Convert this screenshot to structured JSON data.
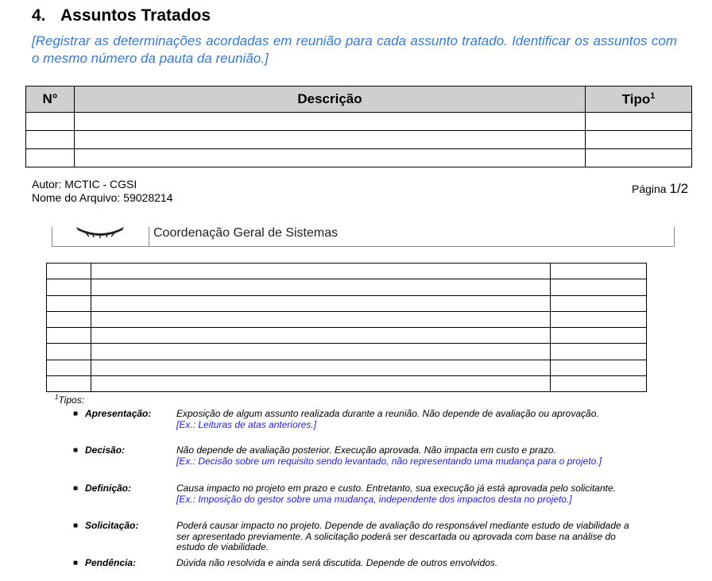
{
  "section": {
    "number": "4.",
    "title": "Assuntos Tratados",
    "instruction": "[Registrar as determinações acordadas em reunião para cada assunto tratado. Identificar os assuntos com o mesmo número da pauta da reunião.]"
  },
  "table1": {
    "headers": {
      "num": "N°",
      "descricao": "Descrição",
      "tipo": "Tipo",
      "tipo_sup": "1"
    },
    "empty_rows": 3
  },
  "footer": {
    "autor": "Autor: MCTIC - CGSI",
    "arquivo": "Nome do Arquivo: 59028214",
    "pagina_label": "Página",
    "pagina_value": "1/2"
  },
  "page2_header": {
    "org": "Coordenação Geral de Sistemas"
  },
  "table2": {
    "empty_rows": 8
  },
  "tipos": {
    "title": "Tipos:",
    "title_sup": "1",
    "items": [
      {
        "name": "Apresentação:",
        "desc": "Exposição de algum assunto realizada durante a reunião. Não depende de avaliação ou aprovação.",
        "ex": "[Ex.: Leituras de atas anteriores.]"
      },
      {
        "name": "Decisão:",
        "desc": "Não depende de avaliação posterior. Execução aprovada. Não impacta em custo e prazo.",
        "ex": "[Ex.: Decisão sobre um requisito sendo levantado, não representando uma mudança para o projeto.]"
      },
      {
        "name": "Definição:",
        "desc": "Causa impacto no projeto em prazo e custo.  Entretanto, sua execução já está aprovada pelo solicitante.",
        "ex": "[Ex.: Imposição do gestor sobre uma mudança, independente dos impactos desta no projeto.]"
      },
      {
        "name": "Solicitação:",
        "desc": "Poderá causar impacto no projeto.  Depende de avaliação do responsável mediante estudo de viabilidade a ser apresentado previamente. A solicitação poderá ser descartada ou aprovada com base na análise do estudo de viabilidade.",
        "ex": ""
      },
      {
        "name": "Pendência:",
        "desc": "Dúvida não resolvida e ainda será discutida. Depende de outros envolvidos.",
        "ex": ""
      }
    ]
  }
}
